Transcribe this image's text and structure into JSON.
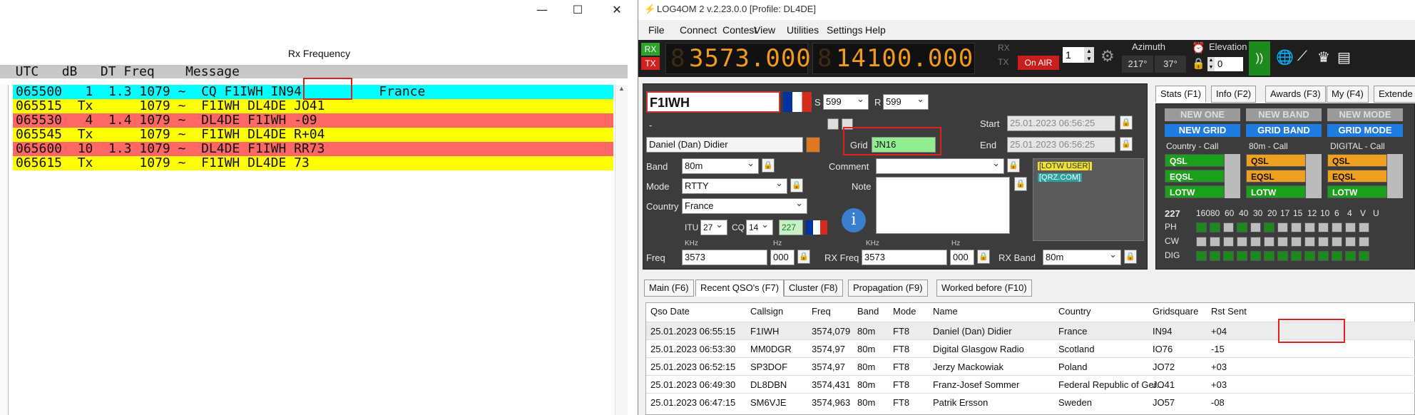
{
  "left": {
    "controls": {
      "minimize": "—",
      "maximize": "☐",
      "close": "✕"
    },
    "title": "Rx Frequency",
    "header": "  UTC   dB   DT Freq    Message",
    "rows": [
      {
        "text": "065500   1  1.3 1079 ~  CQ F1IWH IN94          France",
        "bg": "#00ffff"
      },
      {
        "text": "065515  Tx      1079 ~  F1IWH DL4DE JO41",
        "bg": "#ffff00"
      },
      {
        "text": "065530   4  1.4 1079 ~  DL4DE F1IWH -09",
        "bg": "#ff6666"
      },
      {
        "text": "065545  Tx      1079 ~  F1IWH DL4DE R+04",
        "bg": "#ffff00"
      },
      {
        "text": "065600  10  1.3 1079 ~  DL4DE F1IWH RR73",
        "bg": "#ff6666"
      },
      {
        "text": "065615  Tx      1079 ~  F1IWH DL4DE 73",
        "bg": "#ffff00"
      }
    ]
  },
  "right": {
    "title": "LOG4OM 2 v.2.23.0.0 [Profile: DL4DE]",
    "menu": [
      "File",
      "Connect",
      "Contest",
      "View",
      "Utilities",
      "Settings",
      "Help"
    ],
    "toolbar": {
      "rx": "RX",
      "tx": "TX",
      "freq1_dim": "8",
      "freq1": "3573.000",
      "freq2_dim": "8",
      "freq2": "14100.000",
      "rx_small": "RX",
      "tx_small": "TX",
      "on_air": "On AIR",
      "vfo": "1",
      "azimuth_label": "Azimuth",
      "az1": "217°",
      "az2": "37°",
      "elevation_label": "Elevation",
      "elevation": "0"
    },
    "qso": {
      "callsign": "F1IWH",
      "s_label": "S",
      "s_val": "599",
      "r_label": "R",
      "r_val": "599",
      "dash": "-",
      "start_label": "Start",
      "start": "25.01.2023 06:56:25",
      "end_label": "End",
      "end": "25.01.2023 06:56:25",
      "name": "Daniel (Dan) Didier",
      "grid_label": "Grid",
      "grid": "JN16",
      "band_label": "Band",
      "band": "80m",
      "comment_label": "Comment",
      "mode_label": "Mode",
      "mode": "RTTY",
      "note_label": "Note",
      "country_label": "Country",
      "country": "France",
      "itu_label": "ITU",
      "itu": "27",
      "cq_label": "CQ",
      "cq": "14",
      "dxcc": "227",
      "lotw_tag": "[LOTW USER]",
      "qrz_tag": "[QRZ.COM]",
      "khz1": "KHz",
      "hz1": "Hz",
      "khz2": "KHz",
      "hz2": "Hz",
      "freq_label": "Freq",
      "freq": "3573",
      "freq_hz": "000",
      "rxfreq_label": "RX Freq",
      "rxfreq": "3573",
      "rxfreq_hz": "000",
      "rxband_label": "RX Band",
      "rxband": "80m"
    },
    "stats": {
      "tabs": [
        "Stats (F1)",
        "Info (F2)",
        "Awards (F3)",
        "My (F4)",
        "Extende"
      ],
      "new_one": "NEW ONE",
      "new_band": "NEW BAND",
      "new_mode": "NEW MODE",
      "new_grid": "NEW GRID",
      "grid_band": "GRID BAND",
      "grid_mode": "GRID MODE",
      "col1": "Country - Call",
      "col2": "80m - Call",
      "col3": "DIGITAL - Call",
      "qsl": "QSL",
      "eqsl": "EQSL",
      "lotw": "LOTW",
      "count": "227",
      "bands": [
        "160",
        "80",
        "60",
        "40",
        "30",
        "20",
        "17",
        "15",
        "12",
        "10",
        "6",
        "4",
        "V",
        "U"
      ],
      "rows": [
        "PH",
        "CW",
        "DIG"
      ]
    },
    "bottom_tabs": [
      "Main (F6)",
      "Recent QSO's (F7)",
      "Cluster (F8)",
      "Propagation (F9)",
      "Worked before (F10)"
    ],
    "table": {
      "headers": [
        "Qso Date",
        "Callsign",
        "Freq",
        "Band",
        "Mode",
        "Name",
        "Country",
        "Gridsquare",
        "Rst Sent"
      ],
      "rows": [
        [
          "25.01.2023 06:55:15",
          "F1IWH",
          "3574,079",
          "80m",
          "FT8",
          "Daniel (Dan) Didier",
          "France",
          "IN94",
          "+04"
        ],
        [
          "25.01.2023 06:53:30",
          "MM0DGR",
          "3574,97",
          "80m",
          "FT8",
          "Digital Glasgow Radio",
          "Scotland",
          "IO76",
          "-15"
        ],
        [
          "25.01.2023 06:52:15",
          "SP3DOF",
          "3574,97",
          "80m",
          "FT8",
          "Jerzy Mackowiak",
          "Poland",
          "JO72",
          "+03"
        ],
        [
          "25.01.2023 06:49:30",
          "DL8DBN",
          "3574,431",
          "80m",
          "FT8",
          "Franz-Josef Sommer",
          "Federal Republic of Ger...",
          "JO41",
          "+03"
        ],
        [
          "25.01.2023 06:47:15",
          "SM6VJE",
          "3574,963",
          "80m",
          "FT8",
          "Patrik Ersson",
          "Sweden",
          "JO57",
          "-08"
        ]
      ]
    }
  }
}
